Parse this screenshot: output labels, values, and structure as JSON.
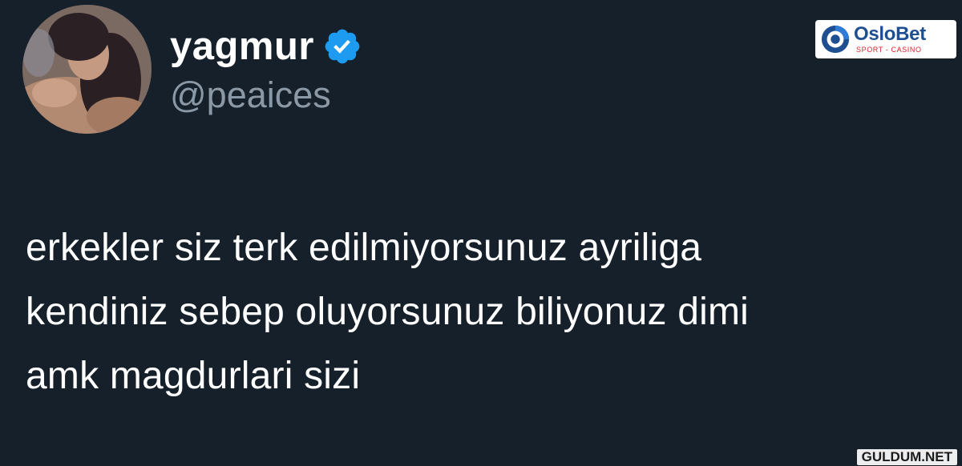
{
  "tweet": {
    "author": {
      "display_name": "yagmur",
      "handle": "@peaices",
      "verified": true,
      "verified_color": "#1d9bf0"
    },
    "text": "erkekler siz terk edilmiyorsunuz ayriliga\nkendiniz sebep oluyorsunuz biliyonuz dimi\namk magdurlari sizi"
  },
  "brand_badge": {
    "name": "OsloBet",
    "tagline": "SPORT - CASINO",
    "icon": "oslobet-logo-icon",
    "primary_color": "#1d4f91",
    "accent_color": "#d8232a"
  },
  "watermark": {
    "text": "GULDUM.NET"
  },
  "colors": {
    "background": "#15202b",
    "text_primary": "#ffffff",
    "text_secondary": "#8b98a5"
  }
}
